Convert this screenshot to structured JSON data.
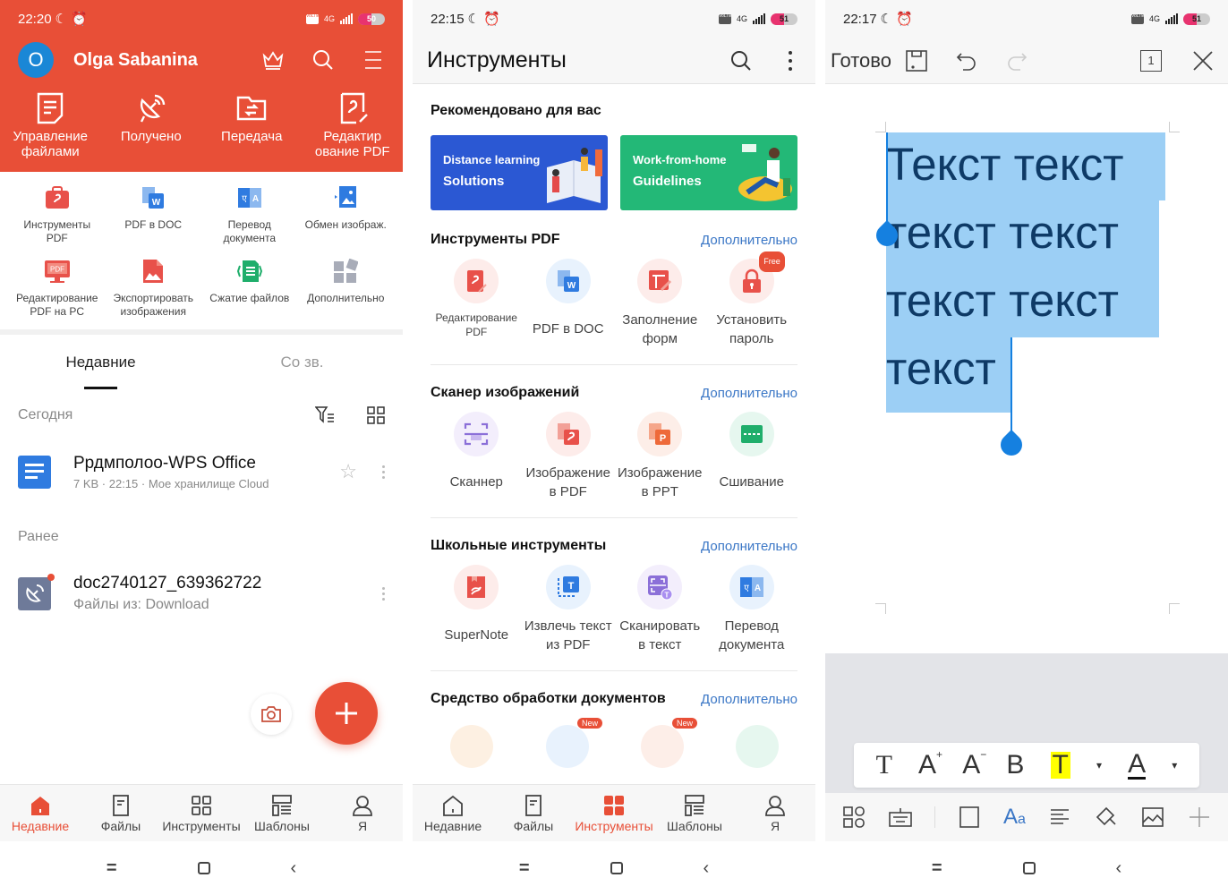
{
  "panel1": {
    "status": {
      "time": "22:20",
      "battery": "50",
      "network": "4G"
    },
    "user": {
      "initial": "O",
      "name": "Olga Sabanina"
    },
    "header_icons": [
      "crown-icon",
      "search-icon",
      "menu-icon"
    ],
    "quick_actions": [
      {
        "label": "Управление файлами",
        "icon": "file-manage-icon"
      },
      {
        "label": "Получено",
        "icon": "satellite-icon"
      },
      {
        "label": "Передача",
        "icon": "transfer-folder-icon"
      },
      {
        "label": "Редактир ование PDF",
        "icon": "pdf-edit-icon"
      }
    ],
    "tools": [
      {
        "label": "Инструменты PDF",
        "icon": "pdf-tools-icon",
        "color": "#e8514a"
      },
      {
        "label": "PDF в DOC",
        "icon": "pdf-to-doc-icon",
        "color": "#2f7be0"
      },
      {
        "label": "Перевод документа",
        "icon": "translate-icon",
        "color": "#2f7be0"
      },
      {
        "label": "Обмен изображ.",
        "icon": "image-exchange-icon",
        "color": "#2f7be0"
      },
      {
        "label": "Редактирование PDF на PC",
        "icon": "pdf-on-pc-icon",
        "color": "#e8514a"
      },
      {
        "label": "Экспортировать изображения",
        "icon": "export-image-icon",
        "color": "#e8514a"
      },
      {
        "label": "Сжатие файлов",
        "icon": "compress-icon",
        "color": "#1fae6b"
      },
      {
        "label": "Дополнительно",
        "icon": "more-apps-icon",
        "color": "#a8acb8"
      }
    ],
    "tabs": [
      {
        "label": "Недавние",
        "active": true
      },
      {
        "label": "Со зв.",
        "active": false
      }
    ],
    "sections": {
      "today": "Сегодня",
      "earlier": "Ранее"
    },
    "files": [
      {
        "name": "Ррдмполоо-WPS Office",
        "meta": "7 KB · 22:15 · Мое хранилище Cloud",
        "type": "doc"
      },
      {
        "name": "doc2740127_639362722",
        "meta": "Файлы из: Download",
        "type": "received"
      }
    ],
    "bottom_nav": [
      {
        "label": "Недавние",
        "active": true
      },
      {
        "label": "Файлы",
        "active": false
      },
      {
        "label": "Инструменты",
        "active": false
      },
      {
        "label": "Шаблоны",
        "active": false
      },
      {
        "label": "Я",
        "active": false
      }
    ]
  },
  "panel2": {
    "status": {
      "time": "22:15",
      "battery": "51",
      "network": "4G"
    },
    "title": "Инструменты",
    "recommended": {
      "title": "Рекомендовано для вас",
      "banners": [
        {
          "line1": "Distance learning",
          "line2": "Solutions",
          "color": "#2b58d3"
        },
        {
          "line1": "Work-from-home",
          "line2": "Guidelines",
          "color": "#23b877"
        }
      ]
    },
    "more_label": "Дополнительно",
    "sections": [
      {
        "title": "Инструменты PDF",
        "items": [
          {
            "label": "Редактирование PDF",
            "small": true,
            "icon": "edit-pdf-icon",
            "bg": "#fdecea",
            "fg": "#e8514a"
          },
          {
            "label": "PDF в DOC",
            "icon": "pdf-to-doc-icon",
            "bg": "#e8f2fd",
            "fg": "#2f7be0"
          },
          {
            "label": "Заполнение форм",
            "icon": "fill-form-icon",
            "bg": "#fdecea",
            "fg": "#e8514a"
          },
          {
            "label": "Установить пароль",
            "icon": "lock-icon",
            "bg": "#fdecea",
            "fg": "#e8514a",
            "badge": "Free"
          }
        ]
      },
      {
        "title": "Сканер изображений",
        "items": [
          {
            "label": "Сканнер",
            "icon": "scanner-icon",
            "bg": "#f3eefc",
            "fg": "#8b6fd8"
          },
          {
            "label": "Изображение в PDF",
            "icon": "image-to-pdf-icon",
            "bg": "#fdecea",
            "fg": "#e8514a"
          },
          {
            "label": "Изображение в PPT",
            "icon": "image-to-ppt-icon",
            "bg": "#fdeee8",
            "fg": "#ee6a3a"
          },
          {
            "label": "Сшивание",
            "icon": "stitch-icon",
            "bg": "#e6f7ef",
            "fg": "#1fae6b"
          }
        ]
      },
      {
        "title": "Школьные инструменты",
        "items": [
          {
            "label": "SuperNote",
            "icon": "supernote-icon",
            "bg": "#fdecea",
            "fg": "#e8514a"
          },
          {
            "label": "Извлечь текст из PDF",
            "icon": "extract-text-icon",
            "bg": "#e8f2fd",
            "fg": "#2f7be0"
          },
          {
            "label": "Сканировать в текст",
            "icon": "scan-to-text-icon",
            "bg": "#f3eefc",
            "fg": "#8b6fd8"
          },
          {
            "label": "Перевод документа",
            "icon": "translate-icon",
            "bg": "#e8f2fd",
            "fg": "#2f7be0"
          }
        ]
      },
      {
        "title": "Средство обработки документов",
        "badges": [
          "New",
          "New"
        ]
      }
    ],
    "bottom_nav": [
      {
        "label": "Недавние",
        "active": false
      },
      {
        "label": "Файлы",
        "active": false
      },
      {
        "label": "Инструменты",
        "active": true
      },
      {
        "label": "Шаблоны",
        "active": false
      },
      {
        "label": "Я",
        "active": false
      }
    ]
  },
  "panel3": {
    "status": {
      "time": "22:17",
      "battery": "51",
      "network": "4G"
    },
    "done_label": "Готово",
    "page_number": "1",
    "document_lines": [
      "Текст текст",
      "текст текст",
      "текст текст",
      "текст"
    ],
    "format_toolbar": [
      "T",
      "A+",
      "A−",
      "B",
      "T",
      "▾",
      "A",
      "▾"
    ],
    "highlight_color": "#ffff00",
    "bottom_tools": [
      "apps-icon",
      "keyboard-icon",
      "select-frame-icon",
      "font-style-icon",
      "align-icon",
      "paint-icon",
      "image-icon",
      "add-icon"
    ]
  },
  "colors": {
    "wps_red": "#e84f37",
    "link_blue": "#3b77c6",
    "selection": "#9ccff5",
    "handle": "#1580e0"
  }
}
